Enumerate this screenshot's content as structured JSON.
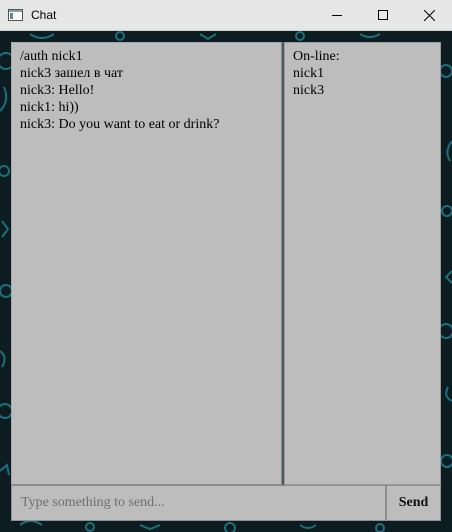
{
  "window": {
    "title": "Chat"
  },
  "chat": {
    "messages": [
      "/auth nick1",
      "nick3 зашел в чат",
      "nick3: Hello!",
      "nick1: hi))",
      "nick3: Do you want to eat or drink?"
    ]
  },
  "users": {
    "header": "On-line:",
    "list": [
      "nick1",
      "nick3"
    ]
  },
  "composer": {
    "placeholder": "Type something to send...",
    "value": "",
    "send_label": "Send"
  },
  "icons": {
    "app": "window-app-icon",
    "minimize": "minimize-icon",
    "maximize": "maximize-icon",
    "close": "close-icon"
  },
  "colors": {
    "panel_bg": "#bdbdbd",
    "background": "#0c1c21",
    "pattern": "#1e7f8c",
    "titlebar": "#e6e6e6"
  }
}
